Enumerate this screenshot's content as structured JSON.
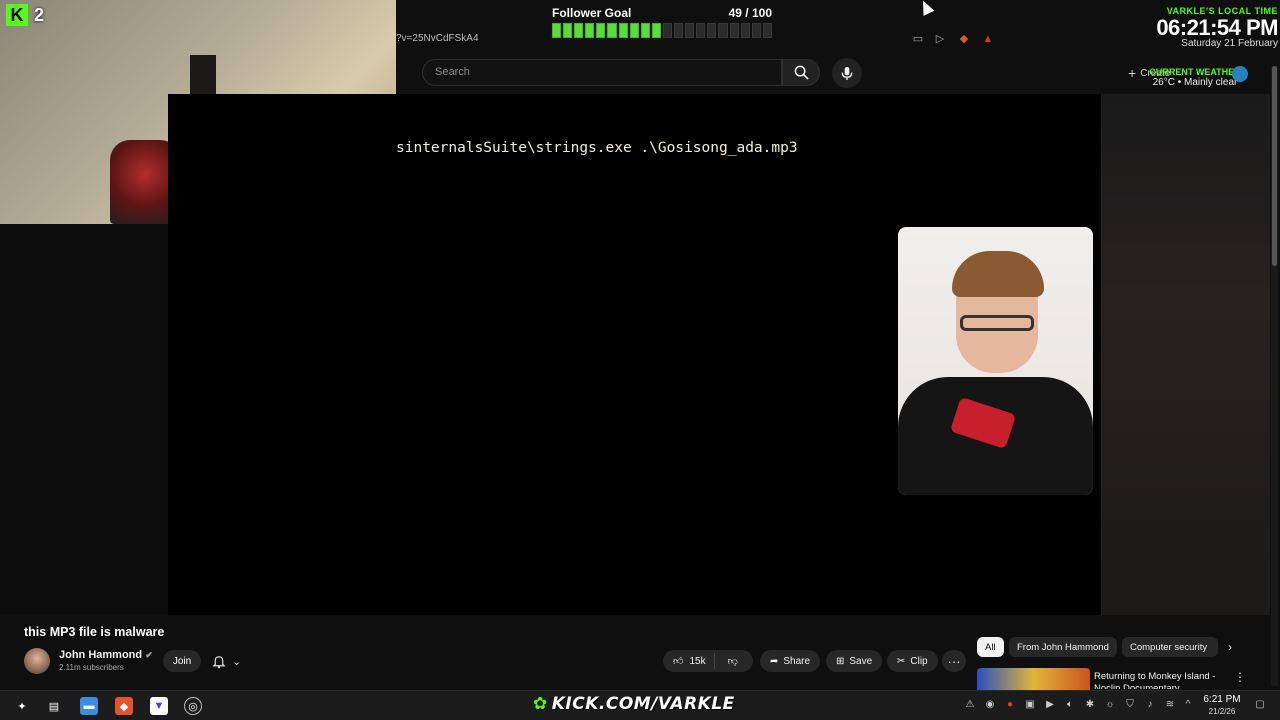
{
  "stream_overlay": {
    "kick_badge_count": "2",
    "follower_goal": {
      "title": "Follower Goal",
      "count": "49 / 100",
      "progress": 0.49
    },
    "clock": {
      "label": "VARKLE'S LOCAL TIME",
      "time": "06:21:54 PM",
      "date": "Saturday 21 February"
    },
    "weather": {
      "label": "CURRENT WEATHER",
      "text": "26°C • Mainly clear"
    },
    "kick_url": "KICK.COM/VARKLE",
    "accent": "#53fc18"
  },
  "browser": {
    "url_fragment": "?v=25NvCdFSkA4",
    "search": {
      "placeholder": "Search"
    },
    "create_label": "Create"
  },
  "video": {
    "terminal_text": "sinternalsSuite\\strings.exe .\\Gosisong_ada.mp3",
    "title": "this MP3 file is malware",
    "channel": {
      "name": "John Hammond",
      "verified": true,
      "subscribers": "2.11m subscribers"
    },
    "join_label": "Join",
    "likes": "15k",
    "actions": {
      "share": "Share",
      "save": "Save",
      "clip": "Clip"
    }
  },
  "chips": [
    "All",
    "From John Hammond",
    "Computer security"
  ],
  "recommendation": {
    "title": "Returning to Monkey Island - Noclip Documentary"
  },
  "taskbar": {
    "time": "6:21 PM",
    "date": "21/2/26"
  }
}
